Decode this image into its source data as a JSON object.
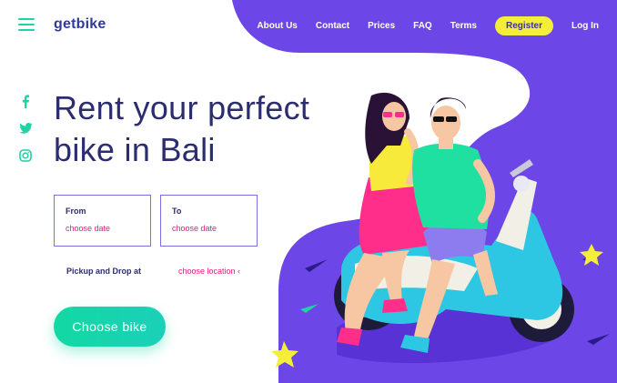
{
  "brand": {
    "name": "getbike"
  },
  "nav": {
    "items": [
      "About Us",
      "Contact",
      "Prices",
      "FAQ",
      "Terms"
    ],
    "register_label": "Register",
    "login_label": "Log In"
  },
  "social": [
    "facebook-icon",
    "twitter-icon",
    "instagram-icon"
  ],
  "hero": {
    "title_line1": "Rent your perfect",
    "title_line2": "bike in Bali"
  },
  "booking": {
    "from_label": "From",
    "from_value": "choose date",
    "to_label": "To",
    "to_value": "choose date",
    "pickup_label": "Pickup and Drop at",
    "pickup_value": "choose location ‹",
    "cta_label": "Choose bike"
  },
  "colors": {
    "accent": "#1fd3a6",
    "purple": "#6c46e6",
    "pink": "#e8197e",
    "yellow": "#f4ee3a",
    "navy": "#2b2d6e"
  }
}
